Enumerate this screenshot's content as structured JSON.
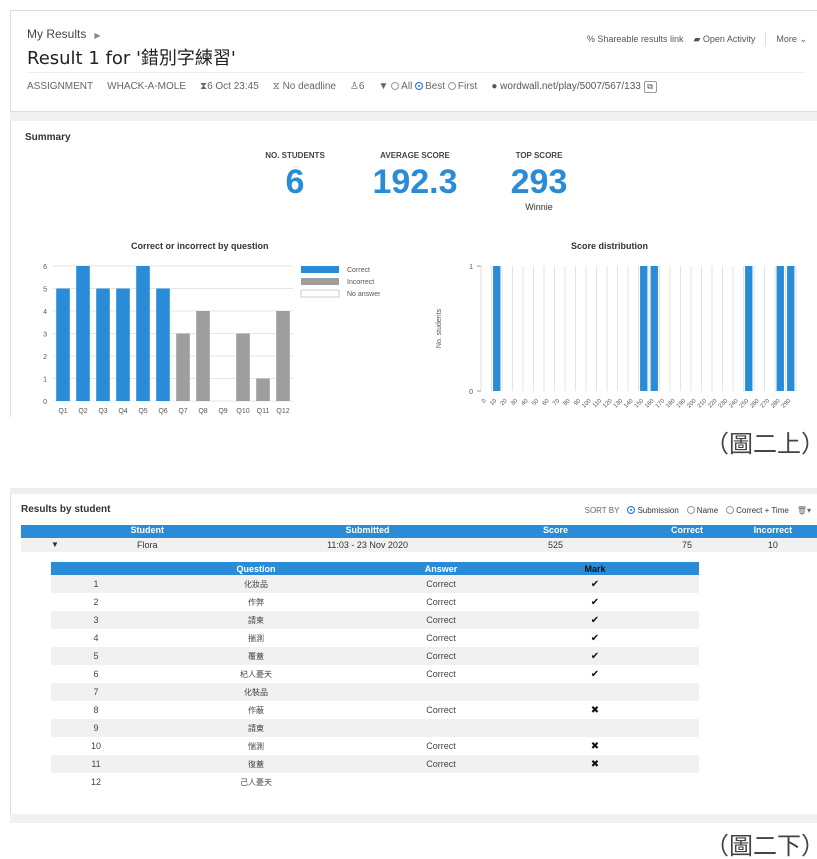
{
  "header": {
    "breadcrumb": "My Results",
    "title": "Result 1 for '錯別字練習'",
    "links": {
      "share": "Shareable results link",
      "open": "Open Activity",
      "more": "More"
    }
  },
  "meta": {
    "type": "ASSIGNMENT",
    "template": "WHACK-A-MOLE",
    "date": "6 Oct 23:45",
    "deadline": "No deadline",
    "students": "6",
    "filter_all": "All",
    "filter_best": "Best",
    "filter_first": "First",
    "url": "wordwall.net/play/5007/567/133"
  },
  "summary": {
    "title": "Summary",
    "no_students_label": "NO. STUDENTS",
    "no_students": "6",
    "avg_label": "AVERAGE SCORE",
    "avg": "192.3",
    "top_label": "TOP SCORE",
    "top": "293",
    "top_name": "Winnie"
  },
  "chart_data": [
    {
      "type": "bar",
      "title": "Correct or incorrect by question",
      "categories": [
        "Q1",
        "Q2",
        "Q3",
        "Q4",
        "Q5",
        "Q6",
        "Q7",
        "Q8",
        "Q9",
        "Q10",
        "Q11",
        "Q12"
      ],
      "series": [
        {
          "name": "Correct",
          "values": [
            5,
            6,
            5,
            5,
            6,
            5,
            0,
            0,
            0,
            0,
            0,
            0
          ],
          "color": "#2a8bd6"
        },
        {
          "name": "Incorrect",
          "values": [
            0,
            0,
            0,
            0,
            0,
            0,
            3,
            4,
            0,
            3,
            1,
            4
          ],
          "color": "#9e9e9e"
        },
        {
          "name": "No answer",
          "values": [
            0,
            0,
            0,
            0,
            0,
            0,
            0,
            0,
            0,
            0,
            0,
            0
          ],
          "color": "#ffffff"
        }
      ],
      "ylim": [
        0,
        6
      ],
      "yticks": [
        0,
        1,
        2,
        3,
        4,
        5,
        6
      ]
    },
    {
      "type": "bar",
      "title": "Score distribution",
      "ylabel": "No. students",
      "categories": [
        "0",
        "10",
        "20",
        "30",
        "40",
        "50",
        "60",
        "70",
        "80",
        "90",
        "100",
        "110",
        "120",
        "130",
        "140",
        "150",
        "160",
        "170",
        "180",
        "190",
        "200",
        "210",
        "220",
        "230",
        "240",
        "250",
        "260",
        "270",
        "280",
        "290"
      ],
      "values": [
        0,
        1,
        0,
        0,
        0,
        0,
        0,
        0,
        0,
        0,
        0,
        0,
        0,
        0,
        0,
        1,
        1,
        0,
        0,
        0,
        0,
        0,
        0,
        0,
        0,
        1,
        0,
        0,
        1,
        1
      ],
      "ylim": [
        0,
        1
      ],
      "yticks": [
        0,
        1
      ]
    }
  ],
  "captions": {
    "top": "（圖二上）",
    "bottom": "（圖二下）"
  },
  "results": {
    "title": "Results by student",
    "sort_label": "SORT BY",
    "sort_options": [
      "Submission",
      "Name",
      "Correct + Time"
    ],
    "columns": [
      "Student",
      "Submitted",
      "Score",
      "Correct",
      "Incorrect"
    ],
    "student": {
      "name": "Flora",
      "submitted": "11:03 - 23 Nov 2020",
      "score": "525",
      "correct": "75",
      "incorrect": "10"
    },
    "question_columns": [
      "Question",
      "Answer",
      "Mark"
    ],
    "questions": [
      {
        "num": "1",
        "text": "化妝品",
        "answer": "Correct",
        "mark": "✔"
      },
      {
        "num": "2",
        "text": "作弊",
        "answer": "Correct",
        "mark": "✔"
      },
      {
        "num": "3",
        "text": "請柬",
        "answer": "Correct",
        "mark": "✔"
      },
      {
        "num": "4",
        "text": "揣測",
        "answer": "Correct",
        "mark": "✔"
      },
      {
        "num": "5",
        "text": "覆蓋",
        "answer": "Correct",
        "mark": "✔"
      },
      {
        "num": "6",
        "text": "杞人憂天",
        "answer": "Correct",
        "mark": "✔"
      },
      {
        "num": "7",
        "text": "化裝品",
        "answer": "",
        "mark": ""
      },
      {
        "num": "8",
        "text": "作蔽",
        "answer": "Correct",
        "mark": "✖"
      },
      {
        "num": "9",
        "text": "請東",
        "answer": "",
        "mark": ""
      },
      {
        "num": "10",
        "text": "惴測",
        "answer": "Correct",
        "mark": "✖"
      },
      {
        "num": "11",
        "text": "復蓋",
        "answer": "Correct",
        "mark": "✖"
      },
      {
        "num": "12",
        "text": "己人憂天",
        "answer": "",
        "mark": ""
      }
    ]
  }
}
